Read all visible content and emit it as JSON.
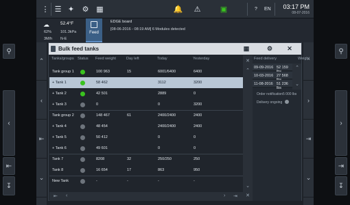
{
  "topbar": {
    "icons": [
      "menu-icon",
      "tools-icon",
      "wrench-icon",
      "settings-icon",
      "grid-icon",
      "bell-icon",
      "warning-icon",
      "network-icon"
    ],
    "help": "?",
    "lang": "EN",
    "time": "03:17 PM",
    "date": "08-07-2016"
  },
  "weather": {
    "temp": "52.4°F",
    "humidity": "62%",
    "pressure": "101.3kPa",
    "wind": "3M/h",
    "direction": "N-E"
  },
  "feed": {
    "label": "Feed"
  },
  "board": {
    "title": "EDGE board",
    "message": "[08-06-2016 - 08:19 AM] 6 Modules detected"
  },
  "panel": {
    "title": "Bulk feed tanks",
    "columns": [
      "Tanks/groups",
      "Status",
      "Feed weight",
      "Day left",
      "Today",
      "Yesterday"
    ],
    "rows": [
      {
        "name": "Tank group 1",
        "status": "green",
        "weight": "100 963",
        "days": "15",
        "today": "6001/6400",
        "yesterday": "6400"
      },
      {
        "name": "+ Tank 1",
        "status": "green",
        "weight": "58 462",
        "days": "",
        "today": "3112",
        "yesterday": "3200",
        "selected": true
      },
      {
        "name": "+ Tank 2",
        "status": "green",
        "weight": "42 501",
        "days": "",
        "today": "2889",
        "yesterday": "0"
      },
      {
        "name": "+ Tank 3",
        "status": "grey",
        "weight": "0",
        "days": "",
        "today": "0",
        "yesterday": "3200"
      },
      {
        "name": "Tank group 2",
        "status": "grey",
        "weight": "148 467",
        "days": "61",
        "today": "2400/2400",
        "yesterday": "2400"
      },
      {
        "name": "+ Tank 4",
        "status": "grey",
        "weight": "48 454",
        "days": "",
        "today": "2400/2400",
        "yesterday": "2400"
      },
      {
        "name": "+ Tank 5",
        "status": "grey",
        "weight": "50 412",
        "days": "",
        "today": "0",
        "yesterday": "0"
      },
      {
        "name": "+ Tank 6",
        "status": "grey",
        "weight": "49 601",
        "days": "",
        "today": "0",
        "yesterday": "0"
      },
      {
        "name": "Tank 7",
        "status": "grey",
        "weight": "8208",
        "days": "32",
        "today": "250/250",
        "yesterday": "250"
      },
      {
        "name": "Tank 8",
        "status": "grey",
        "weight": "16 654",
        "days": "17",
        "today": "863",
        "yesterday": "950"
      },
      {
        "name": "New Tank",
        "status": "grey",
        "weight": "-",
        "days": "-",
        "today": "-",
        "yesterday": "-"
      }
    ]
  },
  "delivery": {
    "col_date": "Feed delivery",
    "col_weight": "Weight",
    "rows": [
      {
        "date": "09-09-2016",
        "weight": "52 159 lbs"
      },
      {
        "date": "10-03-2016",
        "weight": "27 568 lbs"
      },
      {
        "date": "11-08-2016",
        "weight": "51 236 lbs"
      }
    ],
    "notification_label": "Order notification",
    "notification_value": "5 000 lbs",
    "ongoing_label": "Delivery ongoing"
  },
  "colors": {
    "accent": "#3b5f86",
    "status_ok": "#3ac21f",
    "status_idle": "#6d747c",
    "selected_row": "#b9c7d6"
  }
}
